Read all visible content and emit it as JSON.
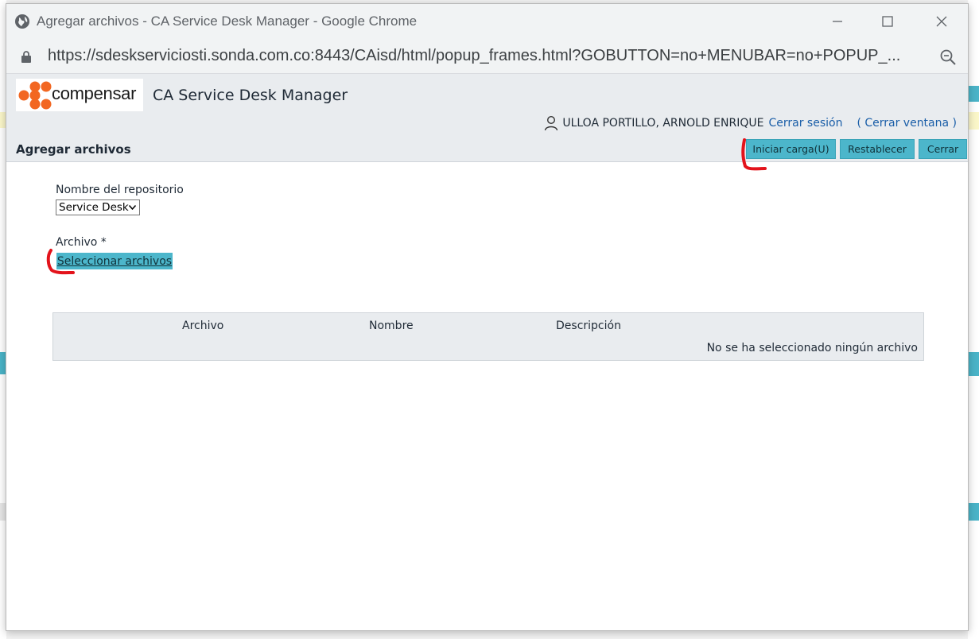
{
  "browser": {
    "window_title": "Agregar archivos - CA Service Desk Manager - Google Chrome",
    "url": "https://sdeskserviciosti.sonda.com.co:8443/CAisd/html/popup_frames.html?GOBUTTON=no+MENUBAR=no+POPUP_..."
  },
  "header": {
    "logo_text": "compensar",
    "product_title": "CA Service Desk Manager",
    "user_name": "ULLOA PORTILLO, ARNOLD ENRIQUE",
    "logout_label": "Cerrar sesión",
    "close_window_label": "( Cerrar ventana )"
  },
  "toolbar": {
    "page_title": "Agregar archivos",
    "start_upload_label": "Iniciar carga(U)",
    "reset_label": "Restablecer",
    "close_label": "Cerrar"
  },
  "form": {
    "repository_label": "Nombre del repositorio",
    "repository_value": "Service Desk",
    "file_label": "Archivo *",
    "select_files_label": "Seleccionar archivos"
  },
  "file_table": {
    "columns": [
      "Archivo",
      "Nombre",
      "Descripción"
    ],
    "empty_message": "No se ha seleccionado ningún archivo"
  },
  "colors": {
    "accent_button": "#4cb6cb",
    "header_bg": "#e9ecef",
    "logo_orange": "#f26722",
    "link": "#1a5ea8",
    "annotation_red": "#e3131b"
  }
}
